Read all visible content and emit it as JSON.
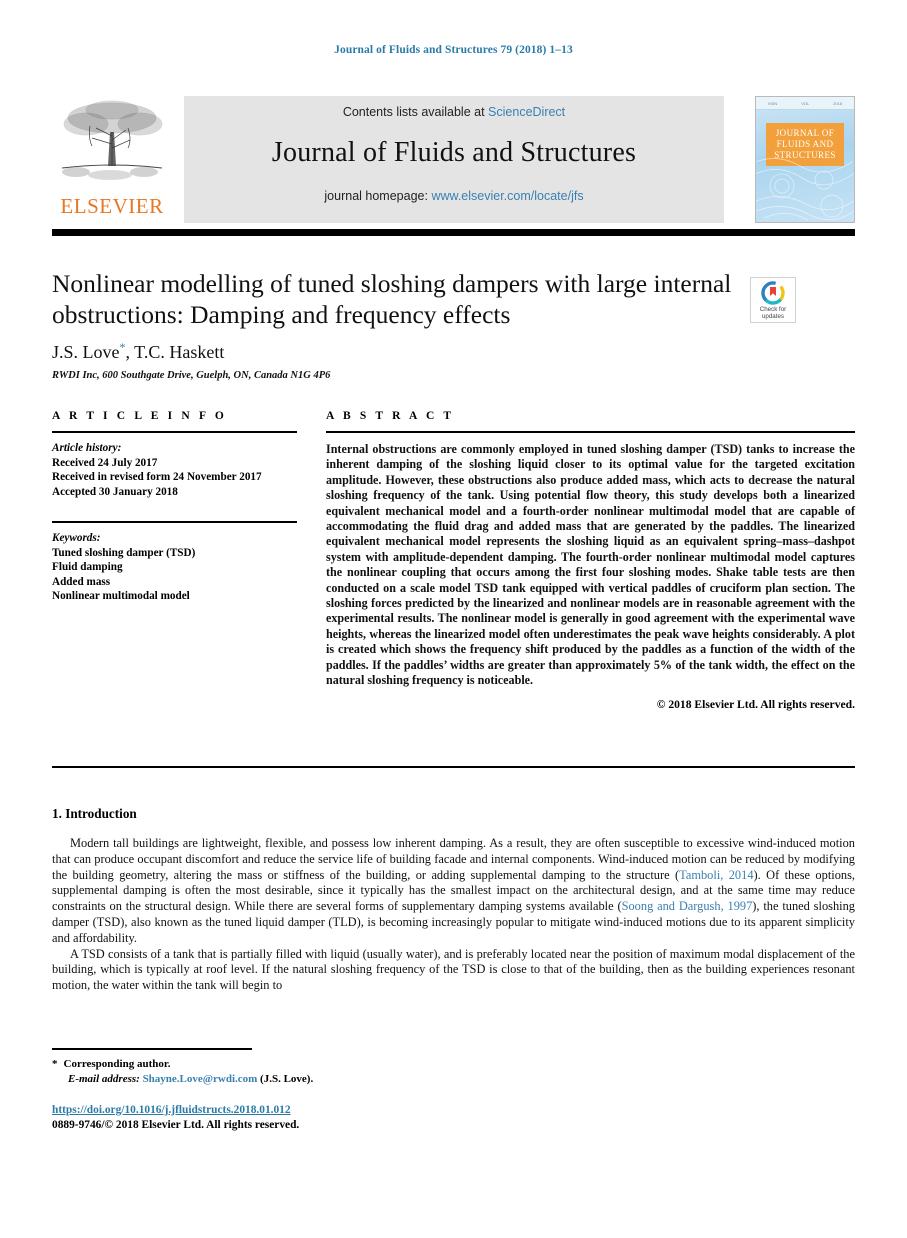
{
  "running_head": "Journal of Fluids and Structures 79 (2018) 1–13",
  "masthead": {
    "publisher": "ELSEVIER",
    "contents_prefix": "Contents lists available at",
    "contents_link": "ScienceDirect",
    "journal_name": "Journal of Fluids and Structures",
    "homepage_prefix": "journal homepage:",
    "homepage_link": "www.elsevier.com/locate/jfs",
    "cover_title": "JOURNAL OF FLUIDS AND STRUCTURES"
  },
  "crossmark": {
    "line1": "Check for",
    "line2": "updates"
  },
  "article": {
    "title": "Nonlinear modelling of tuned sloshing dampers with large internal obstructions: Damping and frequency effects",
    "authors": "J.S. Love",
    "authors_tail": ", T.C. Haskett",
    "affiliation": "RWDI Inc, 600 Southgate Drive, Guelph, ON, Canada N1G 4P6"
  },
  "article_info": {
    "heading": "A R T I C L E   I N F O",
    "history_label": "Article history:",
    "history": [
      "Received 24 July 2017",
      "Received in revised form 24 November 2017",
      "Accepted 30 January 2018"
    ],
    "keywords_label": "Keywords:",
    "keywords": [
      "Tuned sloshing damper (TSD)",
      "Fluid damping",
      "Added mass",
      "Nonlinear multimodal model"
    ]
  },
  "abstract": {
    "heading": "A B S T R A C T",
    "text": "Internal obstructions are commonly employed in tuned sloshing damper (TSD) tanks to increase the inherent damping of the sloshing liquid closer to its optimal value for the targeted excitation amplitude. However, these obstructions also produce added mass, which acts to decrease the natural sloshing frequency of the tank. Using potential flow theory, this study develops both a linearized equivalent mechanical model and a fourth-order nonlinear multimodal model that are capable of accommodating the fluid drag and added mass that are generated by the paddles. The linearized equivalent mechanical model represents the sloshing liquid as an equivalent spring–mass–dashpot system with amplitude-dependent damping. The fourth-order nonlinear multimodal model captures the nonlinear coupling that occurs among the first four sloshing modes. Shake table tests are then conducted on a scale model TSD tank equipped with vertical paddles of cruciform plan section. The sloshing forces predicted by the linearized and nonlinear models are in reasonable agreement with the experimental results. The nonlinear model is generally in good agreement with the experimental wave heights, whereas the linearized model often underestimates the peak wave heights considerably. A plot is created which shows the frequency shift produced by the paddles as a function of the width of the paddles. If the paddles’ widths are greater than approximately 5% of the tank width, the effect on the natural sloshing frequency is noticeable.",
    "copyright": "© 2018 Elsevier Ltd. All rights reserved."
  },
  "introduction": {
    "heading": "1. Introduction",
    "p1_a": "Modern tall buildings are lightweight, flexible, and possess low inherent damping. As a result, they are often susceptible to excessive wind-induced motion that can produce occupant discomfort and reduce the service life of building facade and internal components. Wind-induced motion can be reduced by modifying the building geometry, altering the mass or stiffness of the building, or adding supplemental damping to the structure (",
    "p1_cite1": "Tamboli, 2014",
    "p1_b": "). Of these options, supplemental damping is often the most desirable, since it typically has the smallest impact on the architectural design, and at the same time may reduce constraints on the structural design. While there are several forms of supplementary damping systems available (",
    "p1_cite2": "Soong and Dargush, 1997",
    "p1_c": "), the tuned sloshing damper (TSD), also known as the tuned liquid damper (TLD), is becoming increasingly popular to mitigate wind-induced motions due to its apparent simplicity and affordability.",
    "p2": "A TSD consists of a tank that is partially filled with liquid (usually water), and is preferably located near the position of maximum modal displacement of the building, which is typically at roof level. If the natural sloshing frequency of the TSD is close to that of the building, then as the building experiences resonant motion, the water within the tank will begin to"
  },
  "footer": {
    "corresponding_star": "*",
    "corresponding_label": "Corresponding author.",
    "email_label": "E-mail address:",
    "email": "Shayne.Love@rwdi.com",
    "email_suffix": "(J.S. Love).",
    "doi": "https://doi.org/10.1016/j.jfluidstructs.2018.01.012",
    "issn_line": "0889-9746/© 2018 Elsevier Ltd. All rights reserved."
  },
  "colors": {
    "link_blue": "#3a80b0",
    "head_blue": "#2b7ba8",
    "elsevier_orange": "#e87722",
    "cover_orange": "#f2a03c"
  }
}
